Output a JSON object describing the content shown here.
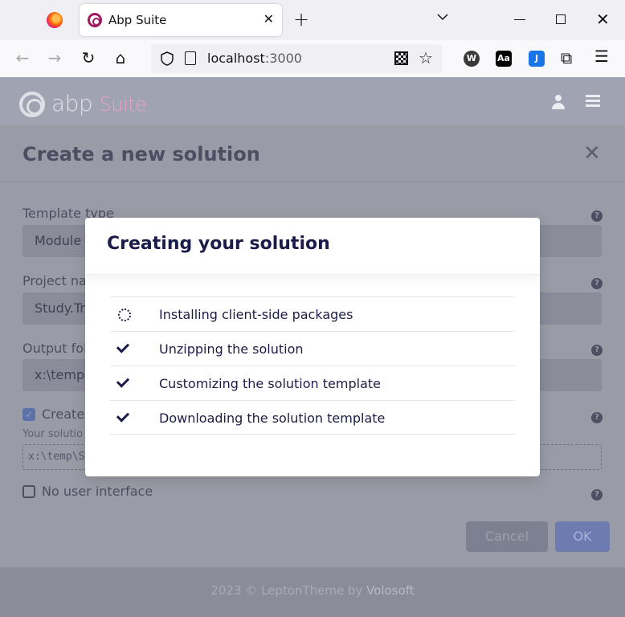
{
  "browser": {
    "tab_title": "Abp Suite",
    "tab_close": "✕",
    "new_tab": "+",
    "url_host": "localhost",
    "url_port": ":3000",
    "ext_w": "W",
    "ext_aa": "Aa",
    "ext_j": "J"
  },
  "app": {
    "logo_main": "abp",
    "logo_suite": "Suite"
  },
  "modal": {
    "title": "Create a new solution",
    "fields": [
      {
        "label": "Template type",
        "value": "Module"
      },
      {
        "label": "Project na",
        "value": "Study.Tr"
      },
      {
        "label": "Output fol",
        "value": "x:\\temp"
      }
    ],
    "create_checkbox_label": "Create",
    "create_checked": true,
    "hint_text": "Your solutio",
    "path_preview": "x:\\temp\\S",
    "no_ui_label": "No user interface",
    "no_ui_checked": false,
    "cancel_label": "Cancel",
    "ok_label": "OK",
    "help_glyph": "?"
  },
  "footer": {
    "text": "2023 © LeptonTheme by ",
    "brand": "Volosoft"
  },
  "dialog": {
    "title": "Creating your solution",
    "steps": [
      {
        "label": "Installing client-side packages",
        "status": "in-progress"
      },
      {
        "label": "Unzipping the solution",
        "status": "done"
      },
      {
        "label": "Customizing the solution template",
        "status": "done"
      },
      {
        "label": "Downloading the solution template",
        "status": "done"
      }
    ]
  },
  "colors": {
    "dialog_text": "#1c1c4a",
    "overlay": "#8a8d99",
    "brand_pink": "#a01b5f"
  }
}
